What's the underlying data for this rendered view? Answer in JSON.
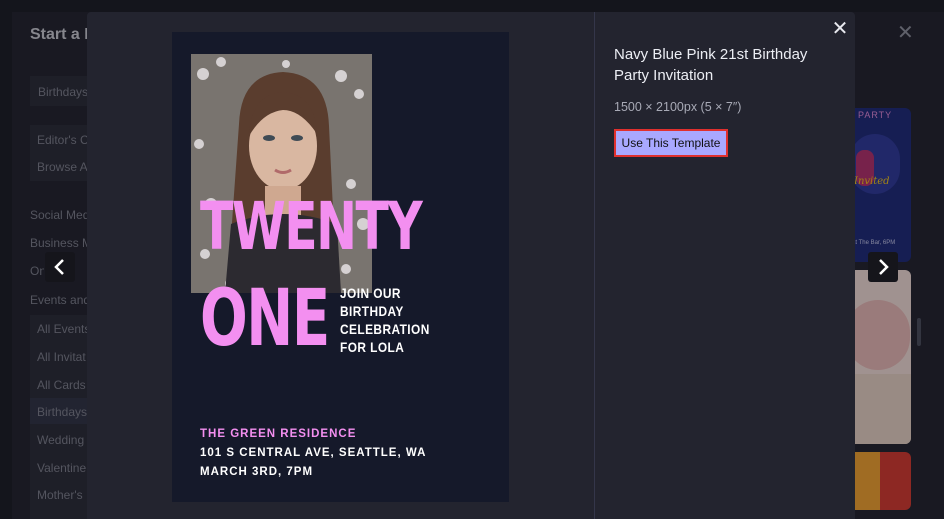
{
  "background": {
    "title": "Start a D",
    "sidebar": {
      "search_tag": "Birthdays",
      "links": [
        "Editor's C",
        "Browse A"
      ],
      "categories": [
        "Social Med",
        "Business M",
        "On",
        "Events and"
      ],
      "subitems": [
        "All Events",
        "All Invitat",
        "All Cards",
        "Birthdays",
        "Wedding",
        "Valentine",
        "Mother's I"
      ]
    },
    "card_texts": {
      "party": "PARTY",
      "invited": "Invited",
      "bar": "at The Bar, 6PM"
    }
  },
  "modal": {
    "title": "Navy Blue Pink 21st Birthday Party Invitation",
    "size": "1500 × 2100px (5 × 7″)",
    "use_button": "Use This Template",
    "close_icon": "close-icon",
    "prev_icon": "chevron-left-icon",
    "next_icon": "chevron-right-icon"
  },
  "poster": {
    "headline_line1": "TWENTY",
    "headline_line2": "ONE",
    "subtext": [
      "JOIN OUR",
      "BIRTHDAY",
      "CELEBRATION",
      "FOR LOLA"
    ],
    "venue": "THE GREEN RESIDENCE",
    "address": "101 S CENTRAL AVE, SEATTLE, WA",
    "date": "MARCH 3RD, 7PM"
  },
  "colors": {
    "accent": "#a9a8ff",
    "highlight_border": "#e0302e",
    "poster_pink": "#f38ff0",
    "poster_navy": "#15192a"
  }
}
